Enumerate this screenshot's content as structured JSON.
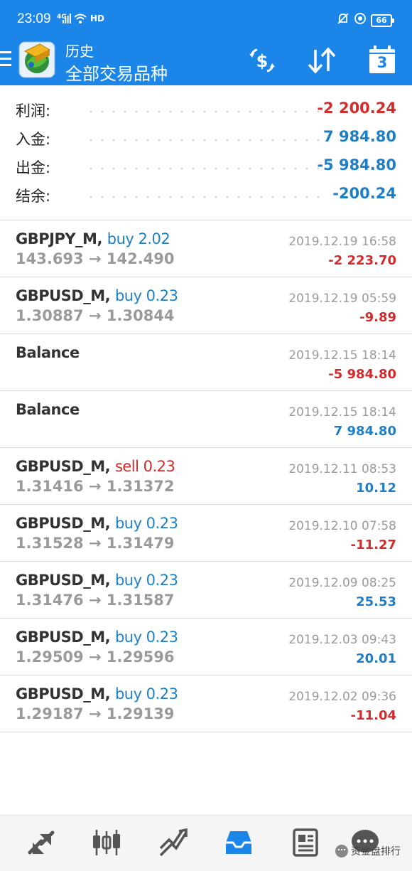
{
  "status_bar": {
    "time": "23:09",
    "network": "4G",
    "hd": "HD",
    "battery": "66"
  },
  "app_bar": {
    "title": "历史",
    "subtitle": "全部交易品种",
    "calendar_day": "3",
    "accent": "#1c86e8"
  },
  "summary": [
    {
      "label": "利润:",
      "value": "-2 200.24",
      "color": "#d12b2b"
    },
    {
      "label": "入金:",
      "value": "7 984.80",
      "color": "#1e7fc6"
    },
    {
      "label": "出金:",
      "value": "-5 984.80",
      "color": "#1e7fc6"
    },
    {
      "label": "结余:",
      "value": "-200.24",
      "color": "#1e7fc6"
    }
  ],
  "trades": [
    {
      "symbol": "GBPJPY_M,",
      "action": "buy 2.02",
      "action_color": "#1e7fc6",
      "prices": "143.693 → 142.490",
      "datetime": "2019.12.19 16:58",
      "profit": "-2 223.70",
      "profit_color": "#d12b2b"
    },
    {
      "symbol": "GBPUSD_M,",
      "action": "buy 0.23",
      "action_color": "#1e7fc6",
      "prices": "1.30887 → 1.30844",
      "datetime": "2019.12.19 05:59",
      "profit": "-9.89",
      "profit_color": "#d12b2b"
    },
    {
      "symbol": "Balance",
      "action": "",
      "action_color": "#1e7fc6",
      "prices": "",
      "datetime": "2019.12.15 18:14",
      "profit": "-5 984.80",
      "profit_color": "#d12b2b"
    },
    {
      "symbol": "Balance",
      "action": "",
      "action_color": "#1e7fc6",
      "prices": "",
      "datetime": "2019.12.15 18:14",
      "profit": "7 984.80",
      "profit_color": "#1e7fc6"
    },
    {
      "symbol": "GBPUSD_M,",
      "action": "sell 0.23",
      "action_color": "#d12b2b",
      "prices": "1.31416 → 1.31372",
      "datetime": "2019.12.11 08:53",
      "profit": "10.12",
      "profit_color": "#1e7fc6"
    },
    {
      "symbol": "GBPUSD_M,",
      "action": "buy 0.23",
      "action_color": "#1e7fc6",
      "prices": "1.31528 → 1.31479",
      "datetime": "2019.12.10 07:58",
      "profit": "-11.27",
      "profit_color": "#d12b2b"
    },
    {
      "symbol": "GBPUSD_M,",
      "action": "buy 0.23",
      "action_color": "#1e7fc6",
      "prices": "1.31476 → 1.31587",
      "datetime": "2019.12.09 08:25",
      "profit": "25.53",
      "profit_color": "#1e7fc6"
    },
    {
      "symbol": "GBPUSD_M,",
      "action": "buy 0.23",
      "action_color": "#1e7fc6",
      "prices": "1.29509 → 1.29596",
      "datetime": "2019.12.03 09:43",
      "profit": "20.01",
      "profit_color": "#1e7fc6"
    },
    {
      "symbol": "GBPUSD_M,",
      "action": "buy 0.23",
      "action_color": "#1e7fc6",
      "prices": "1.29187 → 1.29139",
      "datetime": "2019.12.02 09:36",
      "profit": "-11.04",
      "profit_color": "#d12b2b"
    }
  ],
  "bottom_nav": {
    "items": [
      "quotes-icon",
      "chart-icon",
      "trade-icon",
      "history-icon",
      "news-icon",
      "chat-icon"
    ],
    "active_color": "#1c86e8",
    "inactive_color": "#555555"
  },
  "watermark": "资金盘排行"
}
